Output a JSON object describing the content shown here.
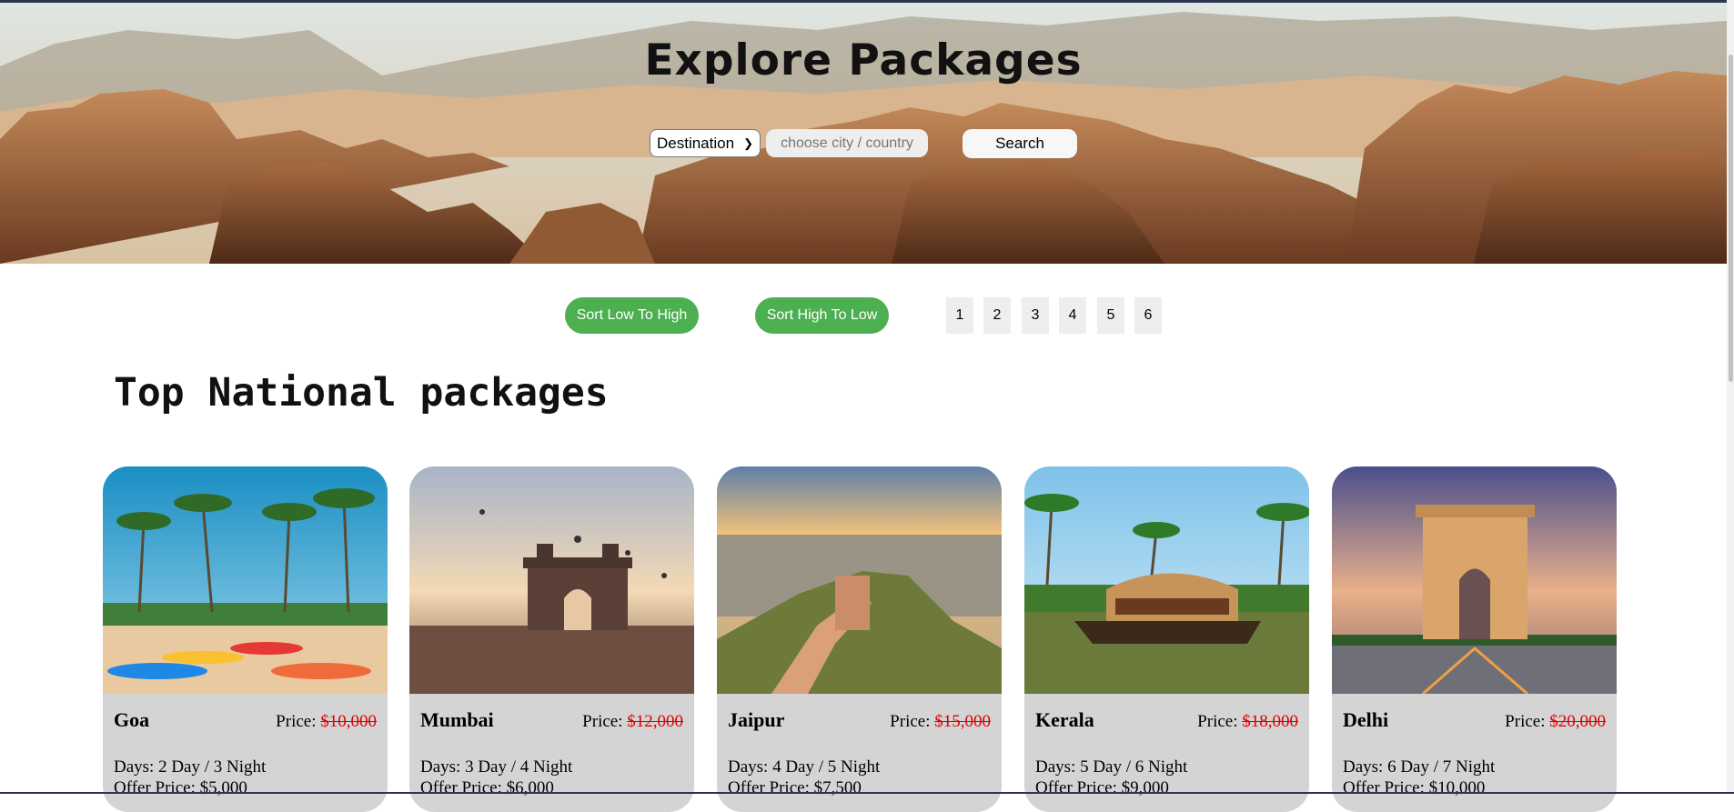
{
  "hero": {
    "title": "Explore Packages",
    "destination_select": "Destination",
    "city_placeholder": "choose city / country",
    "search_label": "Search"
  },
  "controls": {
    "sort_low_label": "Sort Low To High",
    "sort_high_label": "Sort High To Low",
    "pages": [
      "1",
      "2",
      "3",
      "4",
      "5",
      "6"
    ]
  },
  "section_title": "Top National packages",
  "packages": [
    {
      "name": "Goa",
      "price_label": "Price:",
      "original_price": "$10,000",
      "days": "Days: 2 Day / 3 Night",
      "offer": "Offer Price: $5,000"
    },
    {
      "name": "Mumbai",
      "price_label": "Price:",
      "original_price": "$12,000",
      "days": "Days: 3 Day / 4 Night",
      "offer": "Offer Price: $6,000"
    },
    {
      "name": "Jaipur",
      "price_label": "Price:",
      "original_price": "$15,000",
      "days": "Days: 4 Day / 5 Night",
      "offer": "Offer Price: $7,500"
    },
    {
      "name": "Kerala",
      "price_label": "Price:",
      "original_price": "$18,000",
      "days": "Days: 5 Day / 6 Night",
      "offer": "Offer Price: $9,000"
    },
    {
      "name": "Delhi",
      "price_label": "Price:",
      "original_price": "$20,000",
      "days": "Days: 6 Day / 7 Night",
      "offer": "Offer Price: $10,000"
    }
  ],
  "colors": {
    "sort_button": "#4caf50",
    "strike_price": "#e00000",
    "card_background": "#d4d4d4"
  }
}
